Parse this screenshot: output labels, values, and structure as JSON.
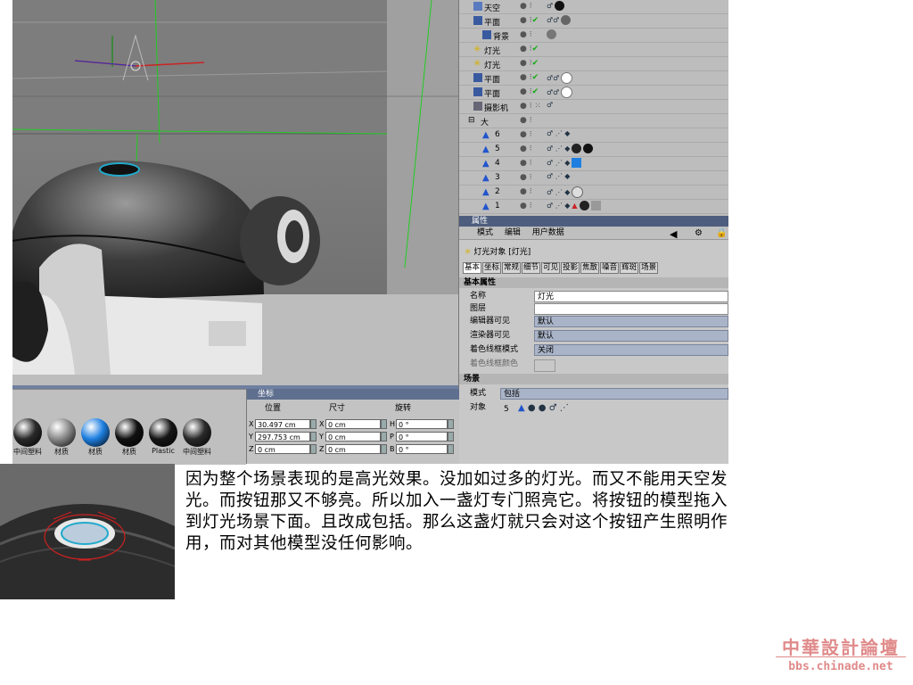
{
  "object_manager": {
    "rows": [
      {
        "name": "天空",
        "indent": 1
      },
      {
        "name": "平面",
        "indent": 1
      },
      {
        "name": "背景",
        "indent": 2
      },
      {
        "name": "灯光",
        "indent": 1
      },
      {
        "name": "灯光",
        "indent": 1
      },
      {
        "name": "平面",
        "indent": 1
      },
      {
        "name": "平面",
        "indent": 1
      },
      {
        "name": "摄影机",
        "indent": 1
      },
      {
        "name": "大",
        "indent": 1
      },
      {
        "name": "6",
        "indent": 2
      },
      {
        "name": "5",
        "indent": 2
      },
      {
        "name": "4",
        "indent": 2
      },
      {
        "name": "3",
        "indent": 2
      },
      {
        "name": "2",
        "indent": 2
      },
      {
        "name": "1",
        "indent": 2
      }
    ]
  },
  "attributes": {
    "panel_title": "属性",
    "menu": [
      "模式",
      "编辑",
      "用户数据"
    ],
    "object_label": "灯光对象 [灯光]",
    "tabs": [
      "基本",
      "坐标",
      "常规",
      "细节",
      "可见",
      "投影",
      "焦散",
      "噪音",
      "辉斑",
      "场景"
    ],
    "section_basic": "基本属性",
    "fields": [
      {
        "label": "名称",
        "value": "灯光"
      },
      {
        "label": "图层",
        "value": ""
      },
      {
        "label": "编辑器可见",
        "value": "默认"
      },
      {
        "label": "渲染器可见",
        "value": "默认"
      },
      {
        "label": "着色线框模式",
        "value": "关闭"
      },
      {
        "label": "着色线框颜色",
        "value": ""
      }
    ],
    "section_scene": "场景",
    "mode_label": "模式",
    "mode_value": "包括",
    "object_label2": "对象",
    "object_count": "5"
  },
  "materials": {
    "items": [
      {
        "label": "中间塑料",
        "color": "#2a2a2a"
      },
      {
        "label": "材质",
        "color": "#8a8a8a"
      },
      {
        "label": "材质",
        "color": "#1e7fe0"
      },
      {
        "label": "材质",
        "color": "#111111"
      },
      {
        "label": "Plastic",
        "color": "#161616"
      },
      {
        "label": "中间塑料",
        "color": "#2a2a2a"
      }
    ]
  },
  "coordinates": {
    "title": "坐标",
    "headers": [
      "位置",
      "尺寸",
      "旋转"
    ],
    "position": {
      "X": "30.497 cm",
      "Y": "297.753 cm",
      "Z": "0 cm"
    },
    "size": {
      "X": "0 cm",
      "Y": "0 cm",
      "Z": "0 cm"
    },
    "rotation": {
      "H": "0 °",
      "P": "0 °",
      "B": "0 °"
    }
  },
  "body_text": [
    "因为整个场景表现的是高光效果。没加如过多的灯光。而又不能用天空发",
    "光。而按钮那又不够亮。所以加入一盏灯专门照亮它。将按钮的模型拖入",
    "到灯光场景下面。且改成包括。那么这盏灯就只会对这个按钮产生照明作",
    "用，而对其他模型没任何影响。"
  ],
  "watermark": {
    "name": "中華設計論壇",
    "url": "bbs.chinade.net"
  },
  "colors": {
    "panel_title": "#4d5d7d",
    "drop_field": "#aab4c8",
    "watermark": "#e08a8a"
  }
}
